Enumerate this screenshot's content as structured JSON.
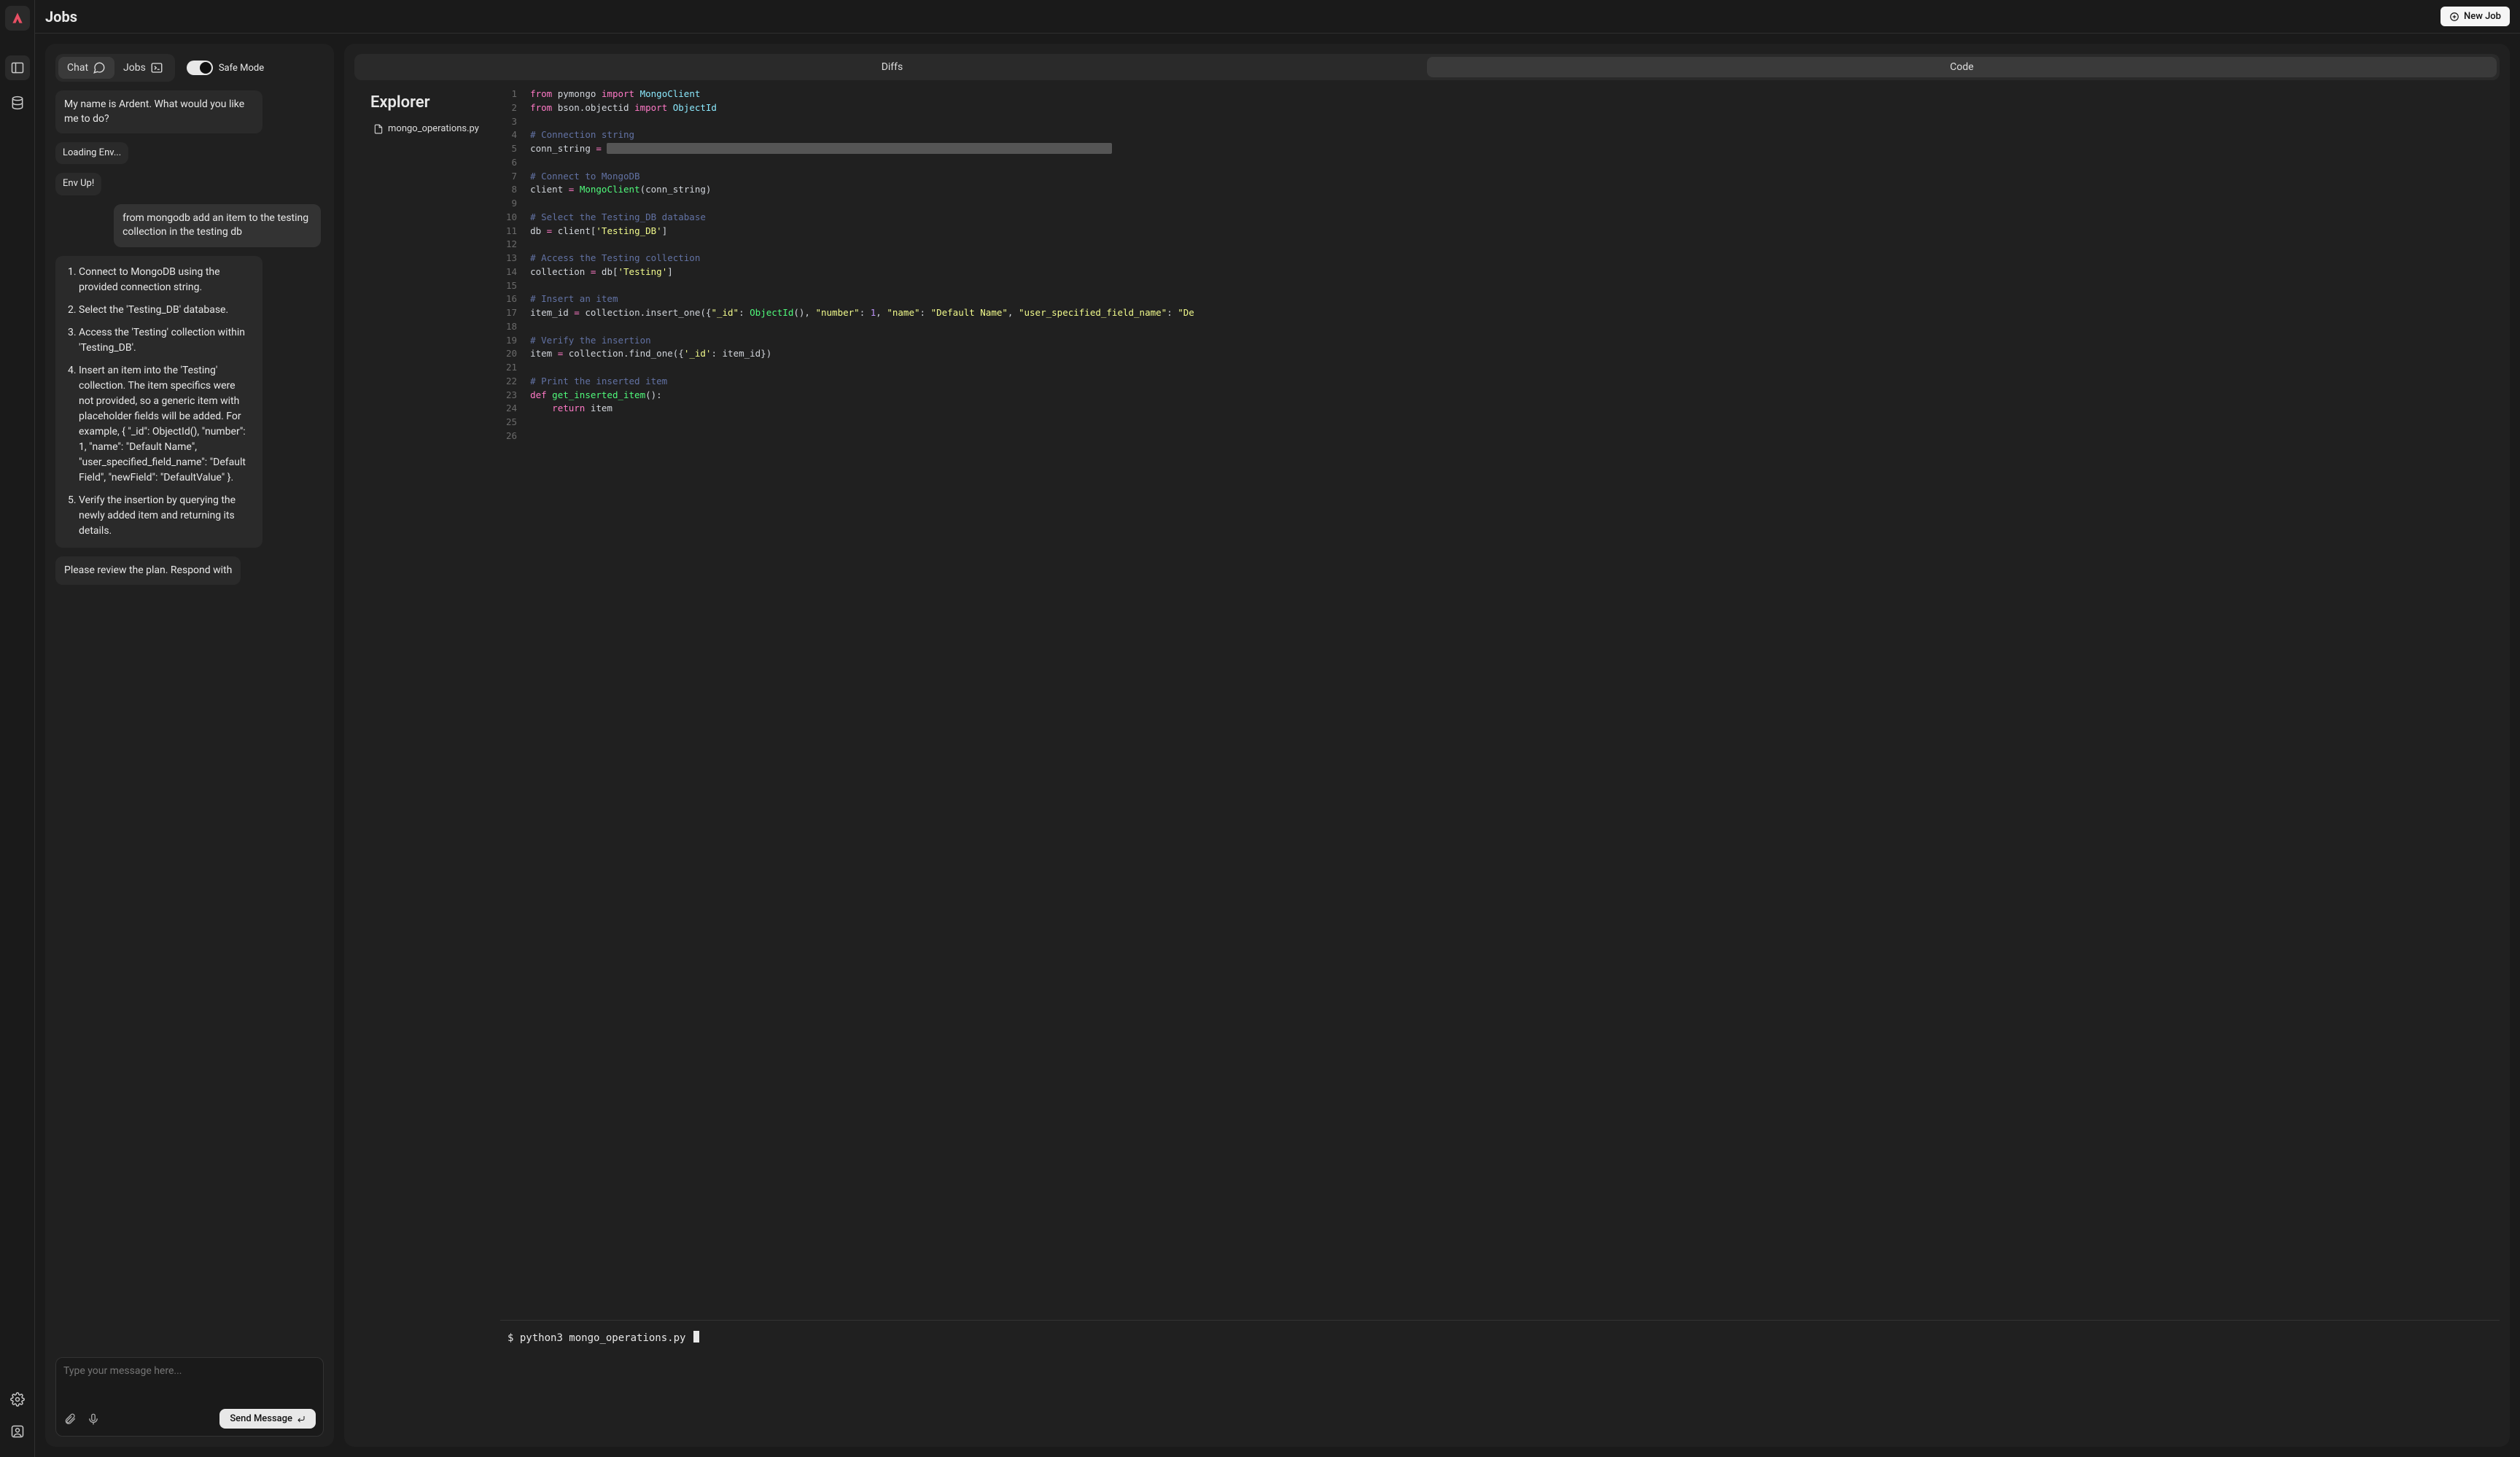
{
  "header": {
    "title": "Jobs",
    "new_job_label": "New Job"
  },
  "rail": {
    "items": [
      "logo",
      "panels",
      "database"
    ],
    "bottom": [
      "settings",
      "profile"
    ]
  },
  "chat": {
    "tabs": {
      "chat": "Chat",
      "jobs": "Jobs"
    },
    "safe_mode_label": "Safe Mode",
    "safe_mode_on": true,
    "messages": {
      "greeting": "My name is Ardent. What would you like me to do?",
      "loading": "Loading Env...",
      "env_up": "Env Up!",
      "user_req": "from mongodb add an item to the testing collection in the testing db",
      "review": "Please review the plan. Respond with"
    },
    "plan": [
      "Connect to MongoDB using the provided connection string.",
      "Select the 'Testing_DB' database.",
      "Access the 'Testing' collection within 'Testing_DB'.",
      "Insert an item into the 'Testing' collection. The item specifics were not provided, so a generic item with placeholder fields will be added. For example, { \"_id\": ObjectId(), \"number\": 1, \"name\": \"Default Name\", \"user_specified_field_name\": \"Default Field\", \"newField\": \"DefaultValue\" }.",
      "Verify the insertion by querying the newly added item and returning its details."
    ],
    "composer": {
      "placeholder": "Type your message here...",
      "send_label": "Send Message"
    }
  },
  "code_panel": {
    "tabs": {
      "diffs": "Diffs",
      "code": "Code"
    },
    "active_tab": "code",
    "explorer_title": "Explorer",
    "files": [
      "mongo_operations.py"
    ],
    "line_count": 26,
    "terminal_prompt": "$",
    "terminal_cmd": "python3 mongo_operations.py",
    "code_tokens": [
      [
        [
          "kw",
          "from"
        ],
        [
          "",
          " pymongo "
        ],
        [
          "kw",
          "import"
        ],
        [
          "",
          " "
        ],
        [
          "cls",
          "MongoClient"
        ]
      ],
      [
        [
          "kw",
          "from"
        ],
        [
          "",
          " bson.objectid "
        ],
        [
          "kw",
          "import"
        ],
        [
          "",
          " "
        ],
        [
          "cls",
          "ObjectId"
        ]
      ],
      [],
      [
        [
          "cmt",
          "# Connection string"
        ]
      ],
      [
        [
          "",
          "conn_string "
        ],
        [
          "op",
          "="
        ],
        [
          "",
          " "
        ],
        [
          "redact",
          "xxxxxxxxxxxxxxxxxxxxxxxxxxxxxxxxxxxxxxxxxxxxxxxxxxxxxxxxxxxxxxxxxxxxxxxxxxxxxxxxxxxxxxxxxxxx"
        ]
      ],
      [],
      [
        [
          "cmt",
          "# Connect to MongoDB"
        ]
      ],
      [
        [
          "",
          "client "
        ],
        [
          "op",
          "="
        ],
        [
          "",
          " "
        ],
        [
          "fn",
          "MongoClient"
        ],
        [
          "",
          "(conn_string)"
        ]
      ],
      [],
      [
        [
          "cmt",
          "# Select the Testing_DB database"
        ]
      ],
      [
        [
          "",
          "db "
        ],
        [
          "op",
          "="
        ],
        [
          "",
          " client["
        ],
        [
          "str",
          "'Testing_DB'"
        ],
        [
          "",
          "]"
        ]
      ],
      [],
      [
        [
          "cmt",
          "# Access the Testing collection"
        ]
      ],
      [
        [
          "",
          "collection "
        ],
        [
          "op",
          "="
        ],
        [
          "",
          " db["
        ],
        [
          "str",
          "'Testing'"
        ],
        [
          "",
          "]"
        ]
      ],
      [],
      [
        [
          "cmt",
          "# Insert an item"
        ]
      ],
      [
        [
          "",
          "item_id "
        ],
        [
          "op",
          "="
        ],
        [
          "",
          " collection.insert_one({"
        ],
        [
          "str",
          "\"_id\""
        ],
        [
          "",
          ": "
        ],
        [
          "fn",
          "ObjectId"
        ],
        [
          "",
          "(), "
        ],
        [
          "str",
          "\"number\""
        ],
        [
          "",
          ": "
        ],
        [
          "num",
          "1"
        ],
        [
          "",
          ", "
        ],
        [
          "str",
          "\"name\""
        ],
        [
          "",
          ": "
        ],
        [
          "str",
          "\"Default Name\""
        ],
        [
          "",
          ", "
        ],
        [
          "str",
          "\"user_specified_field_name\""
        ],
        [
          "",
          ": "
        ],
        [
          "str",
          "\"De"
        ]
      ],
      [],
      [
        [
          "cmt",
          "# Verify the insertion"
        ]
      ],
      [
        [
          "",
          "item "
        ],
        [
          "op",
          "="
        ],
        [
          "",
          " collection.find_one({"
        ],
        [
          "str",
          "'_id'"
        ],
        [
          "",
          ": item_id})"
        ]
      ],
      [],
      [
        [
          "cmt",
          "# Print the inserted item"
        ]
      ],
      [
        [
          "kw",
          "def"
        ],
        [
          "",
          " "
        ],
        [
          "fn",
          "get_inserted_item"
        ],
        [
          "",
          "():"
        ]
      ],
      [
        [
          "",
          "    "
        ],
        [
          "kw",
          "return"
        ],
        [
          "",
          " item"
        ]
      ],
      [],
      []
    ]
  }
}
